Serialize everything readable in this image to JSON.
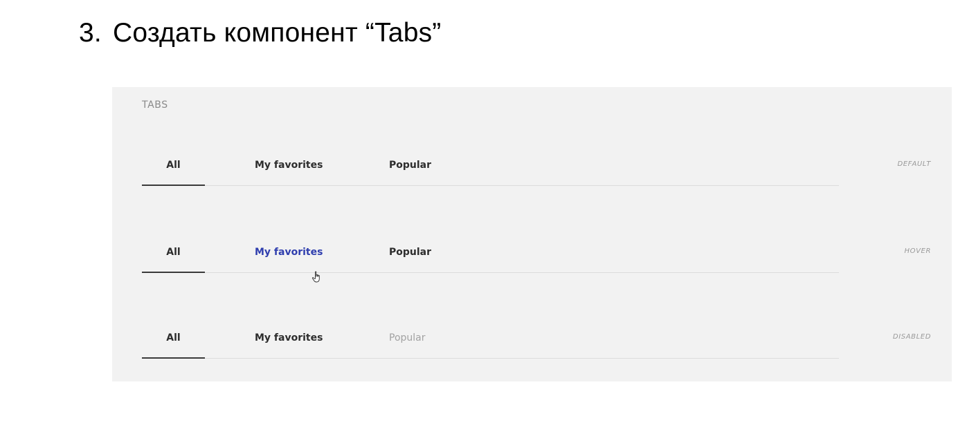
{
  "heading": {
    "number": "3.",
    "text": "Создать компонент “Tabs”"
  },
  "panel": {
    "label": "TABS",
    "rows": [
      {
        "state": "DEFAULT",
        "tabs": [
          {
            "label": "All",
            "selected": true
          },
          {
            "label": "My favorites"
          },
          {
            "label": "Popular"
          }
        ]
      },
      {
        "state": "HOVER",
        "tabs": [
          {
            "label": "All",
            "selected": true
          },
          {
            "label": "My favorites",
            "hovered": true
          },
          {
            "label": "Popular"
          }
        ]
      },
      {
        "state": "DISABLED",
        "tabs": [
          {
            "label": "All",
            "selected": true
          },
          {
            "label": "My favorites"
          },
          {
            "label": "Popular",
            "disabled": true
          }
        ]
      }
    ]
  },
  "colors": {
    "hover_text": "#2f3eae",
    "disabled_text": "#a2a2a2",
    "panel_bg": "#f2f2f2"
  },
  "icons": {
    "cursor": "hand-pointer-icon"
  }
}
